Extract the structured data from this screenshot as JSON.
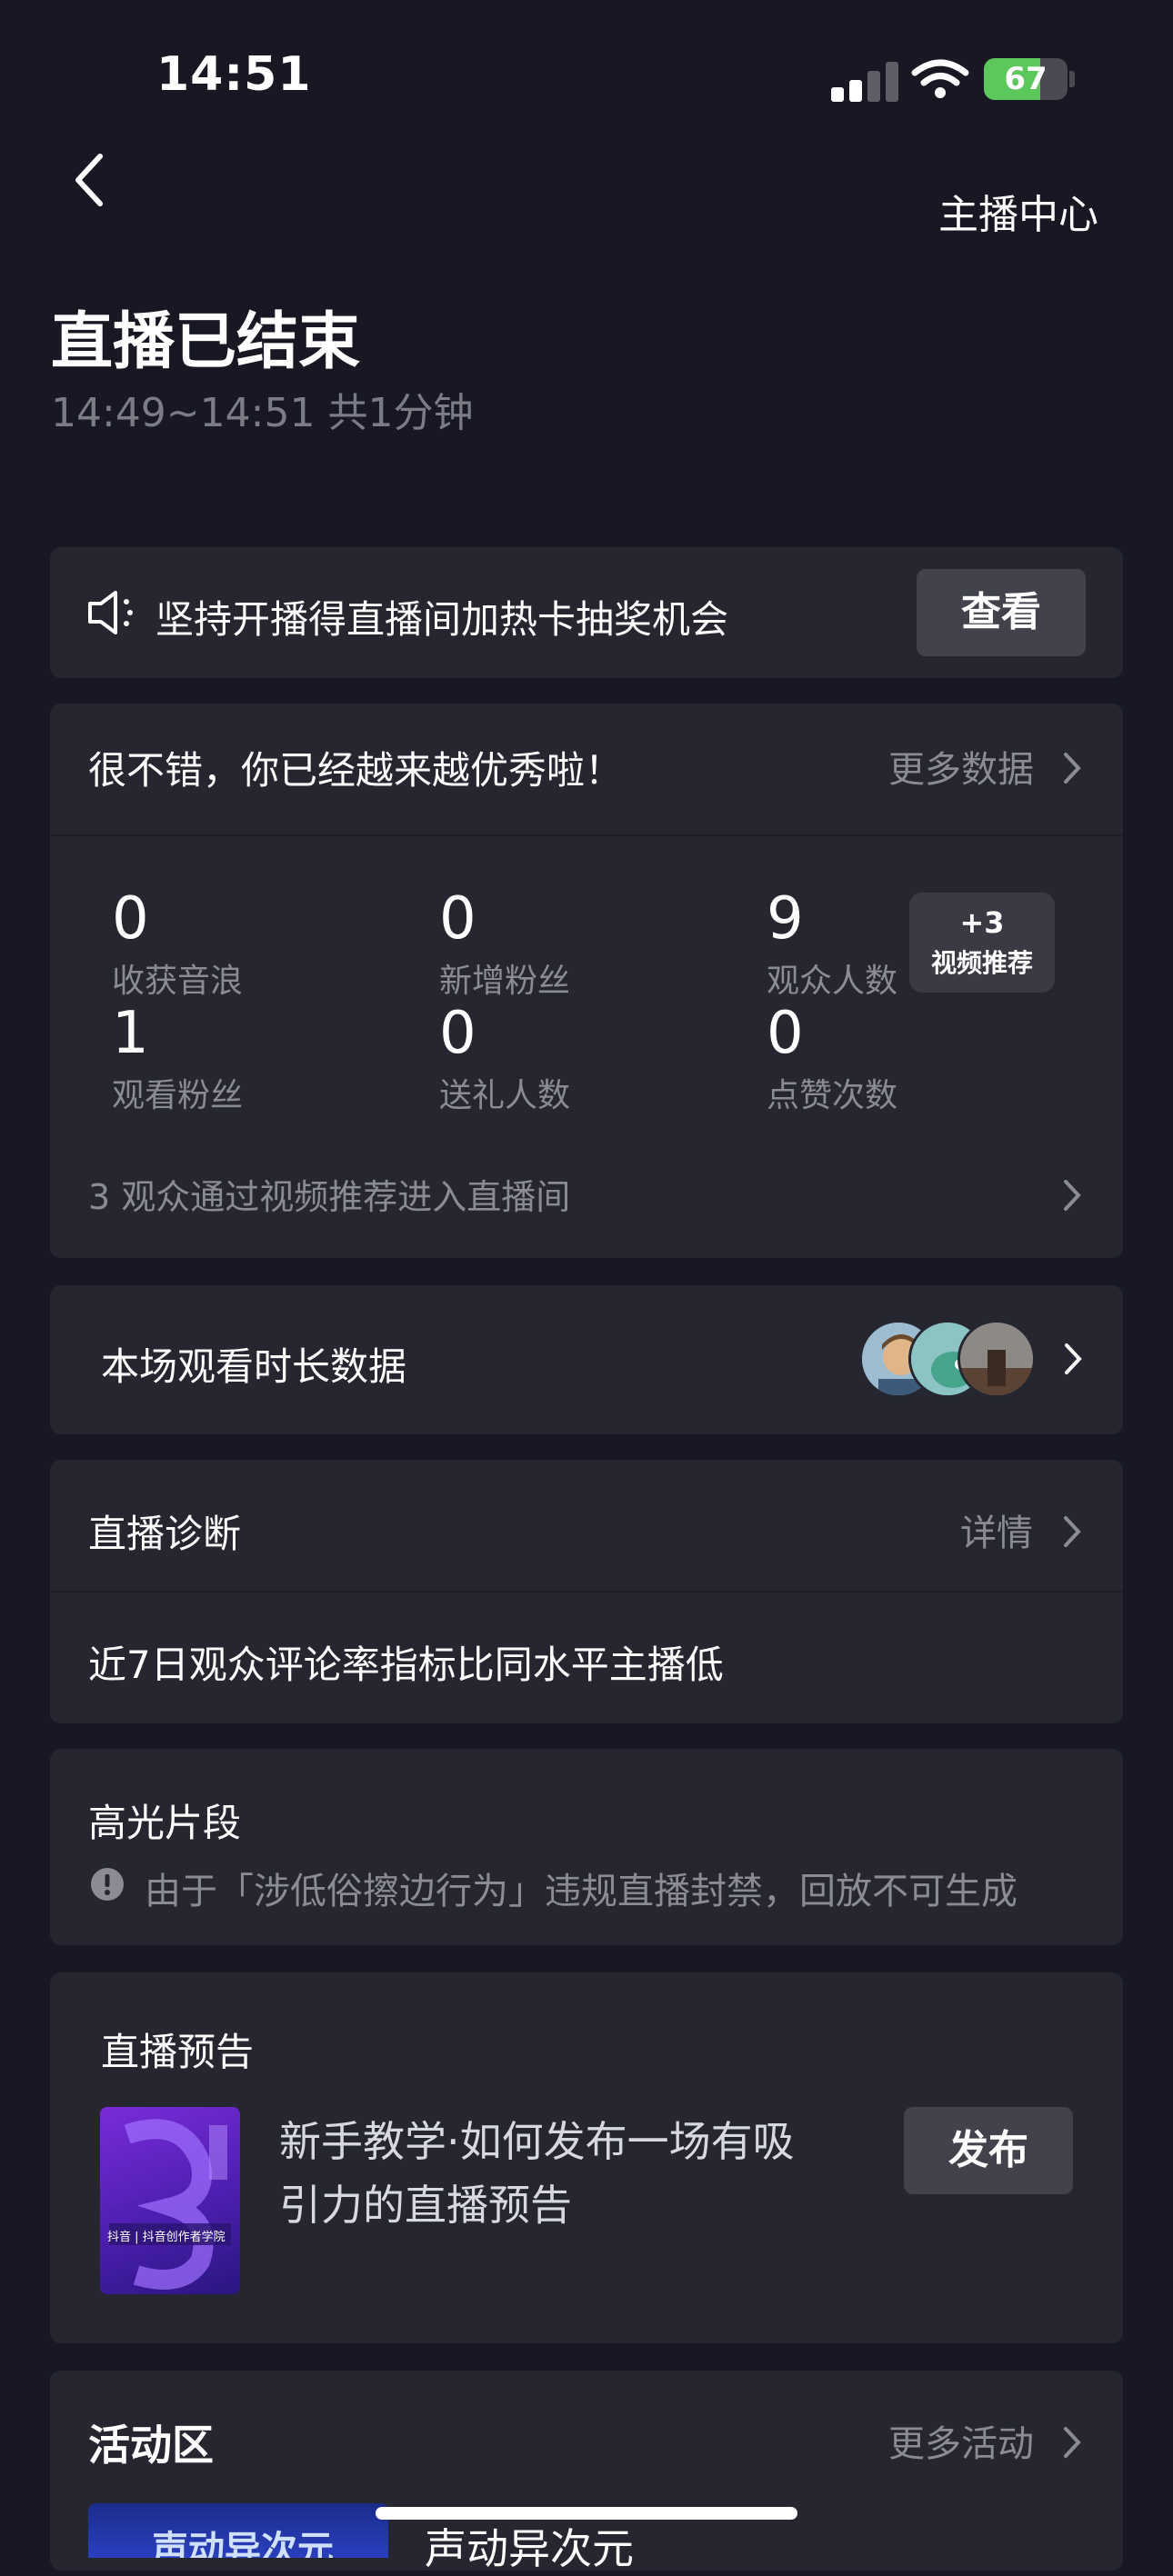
{
  "status_bar": {
    "time": "14:51",
    "battery": "67"
  },
  "header": {
    "host_center_label": "主播中心",
    "title": "直播已结束",
    "subtitle": "14:49~14:51 共1分钟"
  },
  "promo": {
    "text": "坚持开播得直播间加热卡抽奖机会",
    "button": "查看"
  },
  "stats_card": {
    "headline": "很不错，你已经越来越优秀啦！",
    "more_label": "更多数据",
    "stats": [
      {
        "value": "0",
        "label": "收获音浪"
      },
      {
        "value": "0",
        "label": "新增粉丝"
      },
      {
        "value": "9",
        "label": "观众人数"
      },
      {
        "value": "1",
        "label": "观看粉丝"
      },
      {
        "value": "0",
        "label": "送礼人数"
      },
      {
        "value": "0",
        "label": "点赞次数"
      }
    ],
    "badge_top": "+3",
    "badge_bottom": "视频推荐",
    "footer": "3 观众通过视频推荐进入直播间"
  },
  "watch_time": {
    "label": "本场观看时长数据"
  },
  "diagnosis": {
    "title": "直播诊断",
    "detail_label": "详情",
    "message": "近7日观众评论率指标比同水平主播低"
  },
  "highlights": {
    "title": "高光片段",
    "notice": "由于「涉低俗擦边行为」违规直播封禁，回放不可生成"
  },
  "preview": {
    "title": "直播预告",
    "thumb_caption": "抖音 | 抖音创作者学院",
    "description_line1": "新手教学·如何发布一场有吸",
    "description_line2": "引力的直播预告",
    "button": "发布"
  },
  "activity": {
    "title": "活动区",
    "more_label": "更多活动",
    "item_title_partial": "声动异次元",
    "thumb_text": "声动异次元"
  },
  "colors": {
    "background": "#171823",
    "card": "#252630",
    "muted_text": "#8a8b94",
    "battery_green": "#5cc85c"
  }
}
